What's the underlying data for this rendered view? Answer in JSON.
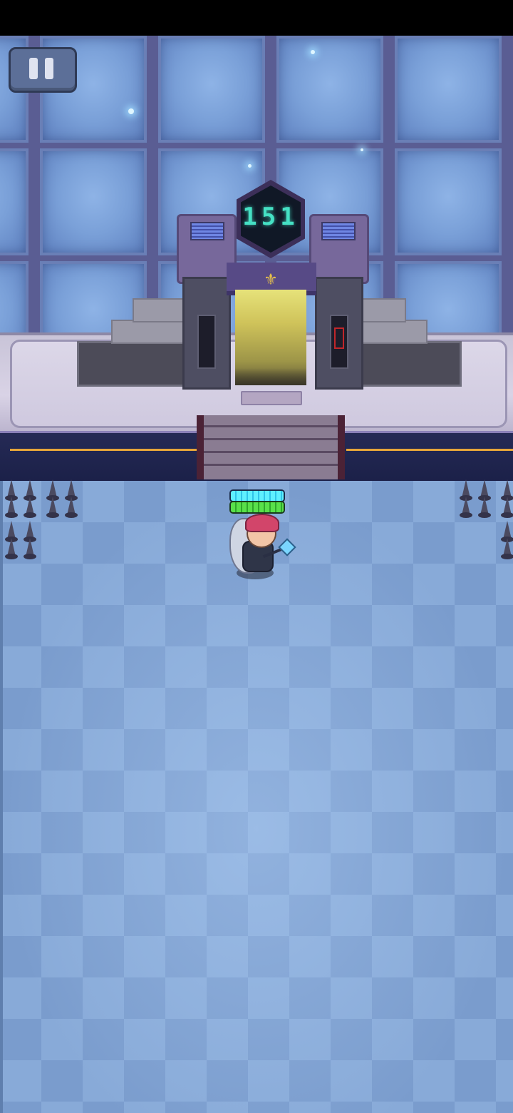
{
  "hud": {
    "pause_icon": "pause-icon",
    "floor_number": "151"
  },
  "player": {
    "energy_level": 1.0,
    "health_level": 1.0
  },
  "colors": {
    "floor_number": "#45e0c4",
    "energy_bar": "#5ff0ff",
    "health_bar": "#59e04a",
    "wall": "#6b7fb8",
    "floor": "#88aad8"
  }
}
